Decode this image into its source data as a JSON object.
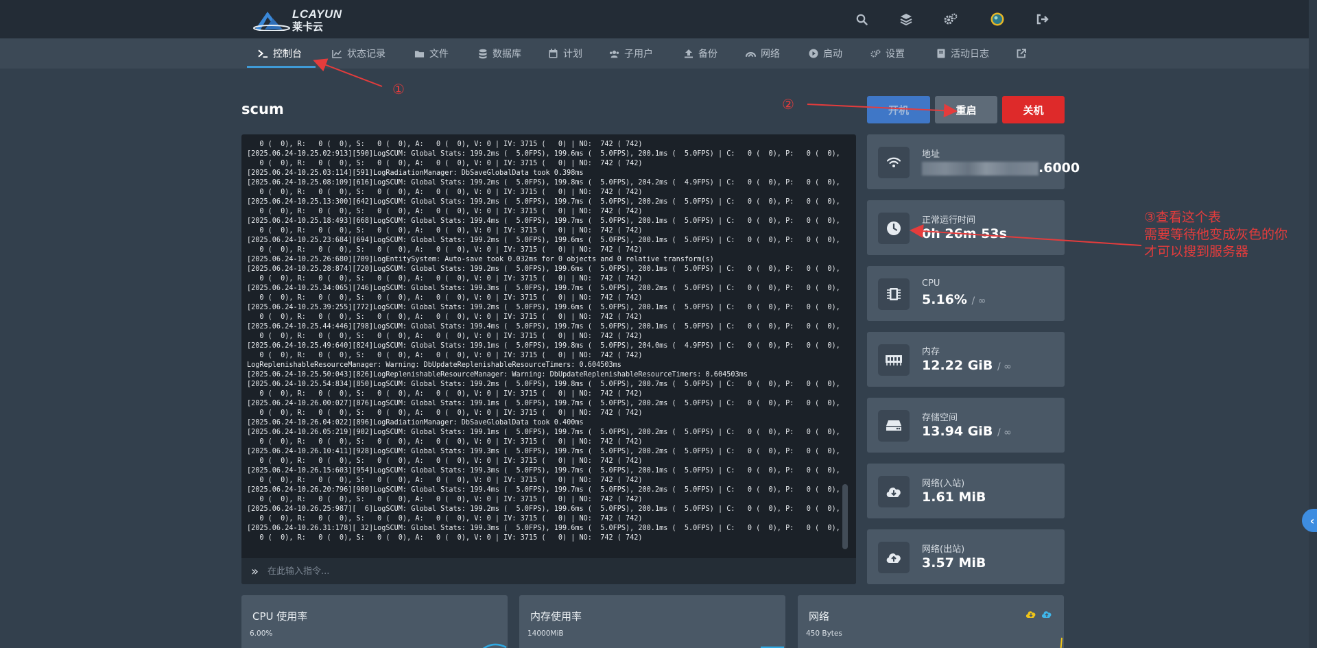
{
  "brand": {
    "name": "LCAYUN",
    "sub": "莱卡云"
  },
  "top_icons": [
    "search-icon",
    "layers-icon",
    "gears-icon",
    "avatar",
    "logout-icon"
  ],
  "nav": {
    "items": [
      {
        "label": "控制台",
        "icon": "terminal-icon",
        "active": true
      },
      {
        "label": "状态记录",
        "icon": "chart-line-icon"
      },
      {
        "label": "文件",
        "icon": "folder-icon"
      },
      {
        "label": "数据库",
        "icon": "database-icon"
      },
      {
        "label": "计划",
        "icon": "calendar-icon"
      },
      {
        "label": "子用户",
        "icon": "users-icon"
      },
      {
        "label": "备份",
        "icon": "upload-icon"
      },
      {
        "label": "网络",
        "icon": "network-icon"
      },
      {
        "label": "启动",
        "icon": "play-icon"
      },
      {
        "label": "设置",
        "icon": "settings-icon"
      },
      {
        "label": "活动日志",
        "icon": "book-icon"
      },
      {
        "label": "",
        "icon": "external-link-icon"
      }
    ]
  },
  "server": {
    "name": "scum"
  },
  "power": {
    "start": "开机",
    "restart": "重启",
    "stop": "关机"
  },
  "console": {
    "lines": [
      "   0 (  0), R:   0 (  0), S:   0 (  0), A:   0 (  0), V: 0 | IV: 3715 (   0) | NO:  742 ( 742)",
      "[2025.06.24-10.25.02:913][590]LogSCUM: Global Stats: 199.2ms (  5.0FPS), 199.6ms (  5.0FPS), 200.1ms (  5.0FPS) | C:   0 (  0), P:   0 (  0), Z:",
      "   0 (  0), R:   0 (  0), S:   0 (  0), A:   0 (  0), V: 0 | IV: 3715 (   0) | NO:  742 ( 742)",
      "[2025.06.24-10.25.03:114][591]LogRadiationManager: DbSaveGlobalData took 0.398ms",
      "[2025.06.24-10.25.08:109][616]LogSCUM: Global Stats: 199.2ms (  5.0FPS), 199.8ms (  5.0FPS), 204.2ms (  4.9FPS) | C:   0 (  0), P:   0 (  0), Z:",
      "   0 (  0), R:   0 (  0), S:   0 (  0), A:   0 (  0), V: 0 | IV: 3715 (   0) | NO:  742 ( 742)",
      "[2025.06.24-10.25.13:300][642]LogSCUM: Global Stats: 199.2ms (  5.0FPS), 199.7ms (  5.0FPS), 200.2ms (  5.0FPS) | C:   0 (  0), P:   0 (  0), Z:",
      "   0 (  0), R:   0 (  0), S:   0 (  0), A:   0 (  0), V: 0 | IV: 3715 (   0) | NO:  742 ( 742)",
      "[2025.06.24-10.25.18:493][668]LogSCUM: Global Stats: 199.4ms (  5.0FPS), 199.7ms (  5.0FPS), 200.1ms (  5.0FPS) | C:   0 (  0), P:   0 (  0), Z:",
      "   0 (  0), R:   0 (  0), S:   0 (  0), A:   0 (  0), V: 0 | IV: 3715 (   0) | NO:  742 ( 742)",
      "[2025.06.24-10.25.23:684][694]LogSCUM: Global Stats: 199.2ms (  5.0FPS), 199.6ms (  5.0FPS), 200.1ms (  5.0FPS) | C:   0 (  0), P:   0 (  0), Z:",
      "   0 (  0), R:   0 (  0), S:   0 (  0), A:   0 (  0), V: 0 | IV: 3715 (   0) | NO:  742 ( 742)",
      "[2025.06.24-10.25.26:680][709]LogEntitySystem: Auto-save took 0.032ms for 0 objects and 0 relative transform(s)",
      "[2025.06.24-10.25.28:874][720]LogSCUM: Global Stats: 199.2ms (  5.0FPS), 199.6ms (  5.0FPS), 200.1ms (  5.0FPS) | C:   0 (  0), P:   0 (  0), Z:",
      "   0 (  0), R:   0 (  0), S:   0 (  0), A:   0 (  0), V: 0 | IV: 3715 (   0) | NO:  742 ( 742)",
      "[2025.06.24-10.25.34:065][746]LogSCUM: Global Stats: 199.3ms (  5.0FPS), 199.7ms (  5.0FPS), 200.2ms (  5.0FPS) | C:   0 (  0), P:   0 (  0), Z:",
      "   0 (  0), R:   0 (  0), S:   0 (  0), A:   0 (  0), V: 0 | IV: 3715 (   0) | NO:  742 ( 742)",
      "[2025.06.24-10.25.39:255][772]LogSCUM: Global Stats: 199.2ms (  5.0FPS), 199.6ms (  5.0FPS), 200.1ms (  5.0FPS) | C:   0 (  0), P:   0 (  0), Z:",
      "   0 (  0), R:   0 (  0), S:   0 (  0), A:   0 (  0), V: 0 | IV: 3715 (   0) | NO:  742 ( 742)",
      "[2025.06.24-10.25.44:446][798]LogSCUM: Global Stats: 199.4ms (  5.0FPS), 199.7ms (  5.0FPS), 200.1ms (  5.0FPS) | C:   0 (  0), P:   0 (  0), Z:",
      "   0 (  0), R:   0 (  0), S:   0 (  0), A:   0 (  0), V: 0 | IV: 3715 (   0) | NO:  742 ( 742)",
      "[2025.06.24-10.25.49:640][824]LogSCUM: Global Stats: 199.1ms (  5.0FPS), 199.8ms (  5.0FPS), 204.0ms (  4.9FPS) | C:   0 (  0), P:   0 (  0), Z:",
      "   0 (  0), R:   0 (  0), S:   0 (  0), A:   0 (  0), V: 0 | IV: 3715 (   0) | NO:  742 ( 742)",
      "LogReplenishableResourceManager: Warning: DbUpdateReplenishableResourceTimers: 0.604503ms",
      "[2025.06.24-10.25.50:043][826]LogReplenishableResourceManager: Warning: DbUpdateReplenishableResourceTimers: 0.604503ms",
      "[2025.06.24-10.25.54:834][850]LogSCUM: Global Stats: 199.2ms (  5.0FPS), 199.8ms (  5.0FPS), 200.7ms (  5.0FPS) | C:   0 (  0), P:   0 (  0), Z:",
      "   0 (  0), R:   0 (  0), S:   0 (  0), A:   0 (  0), V: 0 | IV: 3715 (   0) | NO:  742 ( 742)",
      "[2025.06.24-10.26.00:027][876]LogSCUM: Global Stats: 199.1ms (  5.0FPS), 199.7ms (  5.0FPS), 200.2ms (  5.0FPS) | C:   0 (  0), P:   0 (  0), Z:",
      "   0 (  0), R:   0 (  0), S:   0 (  0), A:   0 (  0), V: 0 | IV: 3715 (   0) | NO:  742 ( 742)",
      "[2025.06.24-10.26.04:022][896]LogRadiationManager: DbSaveGlobalData took 0.400ms",
      "[2025.06.24-10.26.05:219][902]LogSCUM: Global Stats: 199.1ms (  5.0FPS), 199.7ms (  5.0FPS), 200.2ms (  5.0FPS) | C:   0 (  0), P:   0 (  0), Z:",
      "   0 (  0), R:   0 (  0), S:   0 (  0), A:   0 (  0), V: 0 | IV: 3715 (   0) | NO:  742 ( 742)",
      "[2025.06.24-10.26.10:411][928]LogSCUM: Global Stats: 199.3ms (  5.0FPS), 199.7ms (  5.0FPS), 200.2ms (  5.0FPS) | C:   0 (  0), P:   0 (  0), Z:",
      "   0 (  0), R:   0 (  0), S:   0 (  0), A:   0 (  0), V: 0 | IV: 3715 (   0) | NO:  742 ( 742)",
      "[2025.06.24-10.26.15:603][954]LogSCUM: Global Stats: 199.3ms (  5.0FPS), 199.7ms (  5.0FPS), 200.1ms (  5.0FPS) | C:   0 (  0), P:   0 (  0), Z:",
      "   0 (  0), R:   0 (  0), S:   0 (  0), A:   0 (  0), V: 0 | IV: 3715 (   0) | NO:  742 ( 742)",
      "[2025.06.24-10.26.20:796][980]LogSCUM: Global Stats: 199.4ms (  5.0FPS), 199.7ms (  5.0FPS), 200.2ms (  5.0FPS) | C:   0 (  0), P:   0 (  0), Z:",
      "   0 (  0), R:   0 (  0), S:   0 (  0), A:   0 (  0), V: 0 | IV: 3715 (   0) | NO:  742 ( 742)",
      "[2025.06.24-10.26.25:987][  6]LogSCUM: Global Stats: 199.2ms (  5.0FPS), 199.6ms (  5.0FPS), 200.1ms (  5.0FPS) | C:   0 (  0), P:   0 (  0), Z:",
      "   0 (  0), R:   0 (  0), S:   0 (  0), A:   0 (  0), V: 0 | IV: 3715 (   0) | NO:  742 ( 742)",
      "[2025.06.24-10.26.31:178][ 32]LogSCUM: Global Stats: 199.3ms (  5.0FPS), 199.6ms (  5.0FPS), 200.1ms (  5.0FPS) | C:   0 (  0), P:   0 (  0), Z:",
      "   0 (  0), R:   0 (  0), S:   0 (  0), A:   0 (  0), V: 0 | IV: 3715 (   0) | NO:  742 ( 742)"
    ],
    "input_placeholder": "在此输入指令..."
  },
  "stats": [
    {
      "label": "地址",
      "value": ".6000",
      "icon": "wifi-icon",
      "value_obscured": true
    },
    {
      "label": "正常运行时间",
      "value": "0h 26m 53s",
      "icon": "clock-icon"
    },
    {
      "label": "CPU",
      "value": "5.16%",
      "limit": "/ ∞",
      "icon": "cpu-icon"
    },
    {
      "label": "内存",
      "value": "12.22 GiB",
      "limit": "/ ∞",
      "icon": "memory-icon"
    },
    {
      "label": "存储空间",
      "value": "13.94 GiB",
      "limit": "/ ∞",
      "icon": "hdd-icon"
    },
    {
      "label": "网络(入站)",
      "value": "1.61 MiB",
      "icon": "cloud-download-icon"
    },
    {
      "label": "网络(出站)",
      "value": "3.57 MiB",
      "icon": "cloud-upload-icon"
    }
  ],
  "panels": [
    {
      "title": "CPU 使用率",
      "scale": "6.00%"
    },
    {
      "title": "内存使用率",
      "scale": "14000MiB"
    },
    {
      "title": "网络",
      "scale": "450 Bytes"
    }
  ],
  "annotations": {
    "marker1": "①",
    "marker2": "②",
    "note_lines": [
      "③查看这个表",
      "需要等待他变成灰色的你",
      "才可以搜到服务器"
    ]
  },
  "colors": {
    "accent": "#3f9bd7",
    "danger": "#de2a2a",
    "start": "#3f77c7",
    "annotation": "#e53c3c",
    "background": "#33404d"
  }
}
